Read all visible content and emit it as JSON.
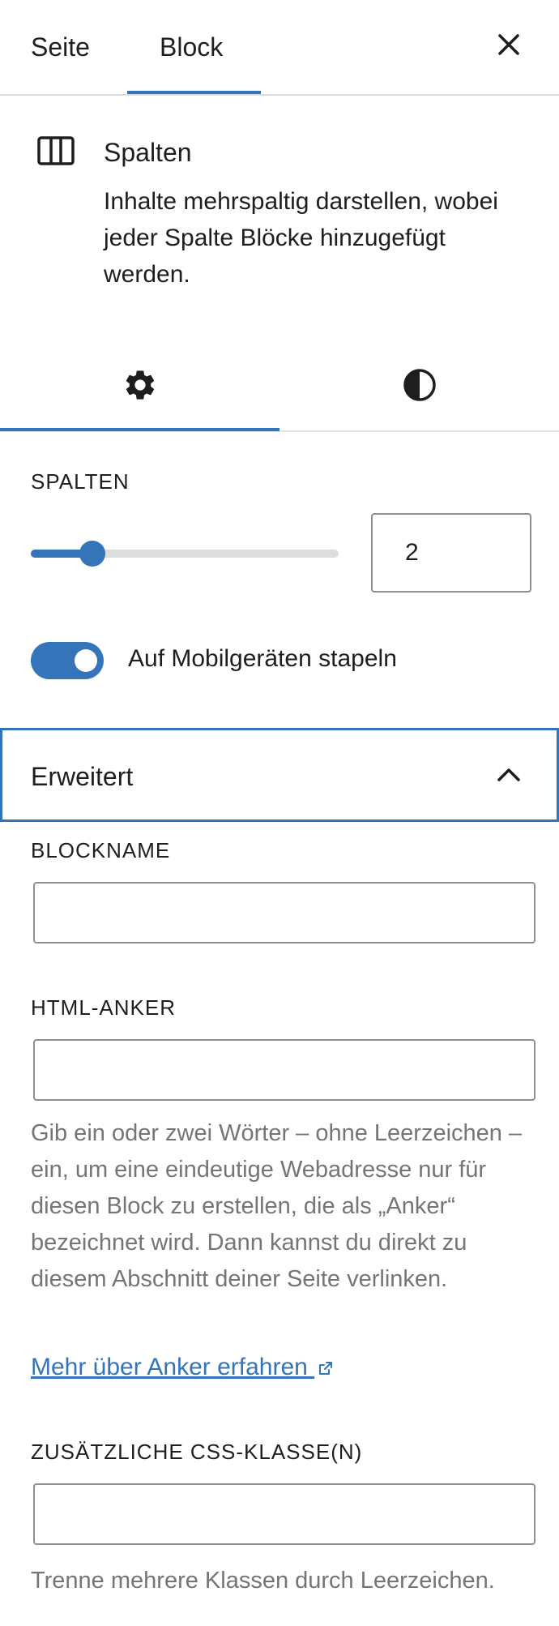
{
  "header": {
    "tabs": [
      {
        "label": "Seite",
        "active": false
      },
      {
        "label": "Block",
        "active": true
      }
    ],
    "close_icon": "close-icon"
  },
  "block_card": {
    "icon": "columns-icon",
    "title": "Spalten",
    "description": "Inhalte mehrspaltig darstellen, wobei jeder Spalte Blöcke hinzugefügt werden."
  },
  "inspector_tabs": [
    {
      "icon": "gear-icon",
      "name": "settings",
      "active": true
    },
    {
      "icon": "contrast-icon",
      "name": "styles",
      "active": false
    }
  ],
  "columns_setting": {
    "label": "Spalten",
    "slider_fraction": 0.2,
    "value": "2"
  },
  "stack_toggle": {
    "label": "Auf Mobilgeräten stapeln",
    "checked": true
  },
  "advanced": {
    "title": "Erweitert",
    "expanded": true,
    "blockname_label": "Blockname",
    "blockname_value": "",
    "anchor_label": "HTML-Anker",
    "anchor_value": "",
    "anchor_help": "Gib ein oder zwei Wörter – ohne Leerzeichen – ein, um eine eindeutige Webadresse nur für diesen Block zu erstellen, die als „Anker“ bezeichnet wird. Dann kannst du direkt zu diesem Abschnitt deiner Seite verlinken.",
    "anchor_link": "Mehr über Anker erfahren",
    "css_label": "Zusätzliche CSS-Klasse(n)",
    "css_value": "",
    "css_help": "Trenne mehrere Klassen durch Leerzeichen."
  },
  "colors": {
    "accent": "#3474b8",
    "text": "#1e1e1e",
    "muted": "#757575"
  }
}
